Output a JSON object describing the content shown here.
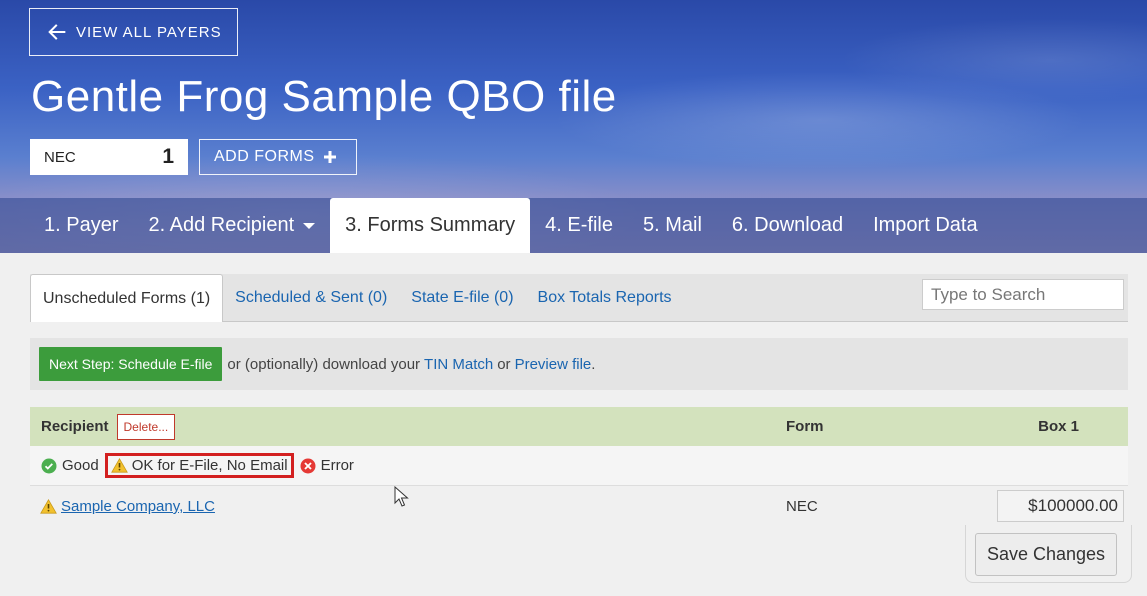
{
  "header": {
    "back_label": "VIEW ALL PAYERS",
    "title": "Gentle Frog Sample QBO file",
    "form_type": "NEC",
    "form_count": "1",
    "add_forms_label": "ADD FORMS"
  },
  "nav": {
    "tabs": [
      {
        "label": "1. Payer"
      },
      {
        "label": "2. Add Recipient"
      },
      {
        "label": "3. Forms Summary"
      },
      {
        "label": "4. E-file"
      },
      {
        "label": "5. Mail"
      },
      {
        "label": "6. Download"
      },
      {
        "label": "Import Data"
      }
    ],
    "active_index": 2
  },
  "subtabs": {
    "items": [
      {
        "label": "Unscheduled Forms (1)"
      },
      {
        "label": "Scheduled & Sent (0)"
      },
      {
        "label": "State E-file (0)"
      },
      {
        "label": "Box Totals Reports"
      }
    ],
    "search_placeholder": "Type to Search"
  },
  "step_bar": {
    "button_label": "Next Step: Schedule E-file",
    "text_1": "or (optionally) download your",
    "link_1": "TIN Match",
    "text_2": "or",
    "link_2": "Preview file",
    "text_3": "."
  },
  "table": {
    "headers": {
      "recipient": "Recipient",
      "delete": "Delete...",
      "form": "Form",
      "box1": "Box 1"
    },
    "legend": {
      "good": "Good",
      "ok": "OK for E-File, No Email",
      "error": "Error"
    },
    "rows": [
      {
        "recipient": "Sample Company, LLC",
        "form": "NEC",
        "box1": "$100000.00"
      }
    ]
  },
  "save_label": "Save Changes",
  "colors": {
    "primary_link": "#1a65b0",
    "green": "#3c9c3c",
    "error_red": "#d32020",
    "table_header": "#d3e2bd"
  }
}
